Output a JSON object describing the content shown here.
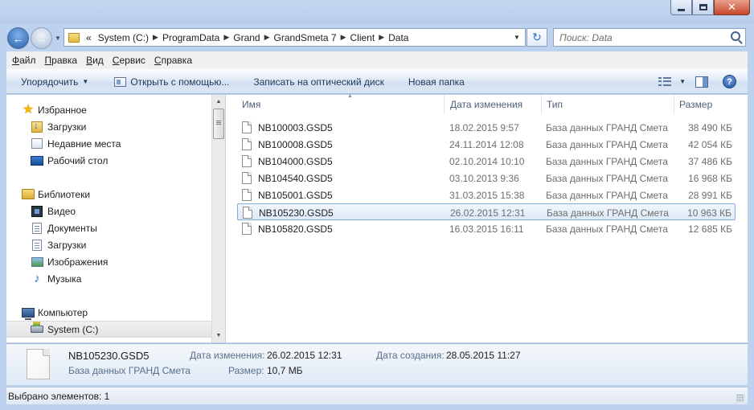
{
  "window": {
    "controls": {
      "minimize_icon": "minimize-icon",
      "maximize_icon": "maximize-icon",
      "close_icon": "close-icon"
    }
  },
  "navigation": {
    "back_icon": "back-arrow-icon",
    "forward_icon": "forward-arrow-icon",
    "overflow": "«",
    "breadcrumbs": [
      "System (C:)",
      "ProgramData",
      "Grand",
      "GrandSmeta 7",
      "Client",
      "Data"
    ],
    "refresh_icon": "refresh-icon",
    "search_placeholder": "Поиск: Data"
  },
  "menubar": {
    "items": [
      {
        "accel": "Ф",
        "rest": "айл"
      },
      {
        "accel": "П",
        "rest": "равка"
      },
      {
        "accel": "В",
        "rest": "ид"
      },
      {
        "accel": "С",
        "rest": "ервис"
      },
      {
        "accel": "С",
        "rest": "правка"
      }
    ]
  },
  "toolbar": {
    "organize": "Упорядочить",
    "open_with": "Открыть с помощью...",
    "burn": "Записать на оптический диск",
    "new_folder": "Новая папка",
    "view_icon": "details-view-icon",
    "preview_pane_icon": "preview-pane-icon",
    "help_icon": "help-icon"
  },
  "sidebar": {
    "favorites": {
      "label": "Избранное",
      "items": [
        "Загрузки",
        "Недавние места",
        "Рабочий стол"
      ]
    },
    "libraries": {
      "label": "Библиотеки",
      "items": [
        "Видео",
        "Документы",
        "Загрузки",
        "Изображения",
        "Музыка"
      ]
    },
    "computer": {
      "label": "Компьютер",
      "items": [
        "System (C:)"
      ]
    }
  },
  "columns": {
    "name": "Имя",
    "date": "Дата изменения",
    "type": "Тип",
    "size": "Размер"
  },
  "files": [
    {
      "name": "NB100003.GSD5",
      "date": "18.02.2015 9:57",
      "type": "База данных ГРАНД Смета",
      "size": "38 490 КБ"
    },
    {
      "name": "NB100008.GSD5",
      "date": "24.11.2014 12:08",
      "type": "База данных ГРАНД Смета",
      "size": "42 054 КБ"
    },
    {
      "name": "NB104000.GSD5",
      "date": "02.10.2014 10:10",
      "type": "База данных ГРАНД Смета",
      "size": "37 486 КБ"
    },
    {
      "name": "NB104540.GSD5",
      "date": "03.10.2013 9:36",
      "type": "База данных ГРАНД Смета",
      "size": "16 968 КБ"
    },
    {
      "name": "NB105001.GSD5",
      "date": "31.03.2015 15:38",
      "type": "База данных ГРАНД Смета",
      "size": "28 991 КБ"
    },
    {
      "name": "NB105230.GSD5",
      "date": "26.02.2015 12:31",
      "type": "База данных ГРАНД Смета",
      "size": "10 963 КБ",
      "selected": true
    },
    {
      "name": "NB105820.GSD5",
      "date": "16.03.2015 16:11",
      "type": "База данных ГРАНД Смета",
      "size": "12 685 КБ"
    }
  ],
  "details": {
    "name": "NB105230.GSD5",
    "type": "База данных ГРАНД Смета",
    "modified_label": "Дата изменения:",
    "modified_value": "26.02.2015 12:31",
    "created_label": "Дата создания:",
    "created_value": "28.05.2015 11:27",
    "size_label": "Размер:",
    "size_value": "10,7 МБ"
  },
  "status": {
    "text": "Выбрано элементов: 1"
  }
}
